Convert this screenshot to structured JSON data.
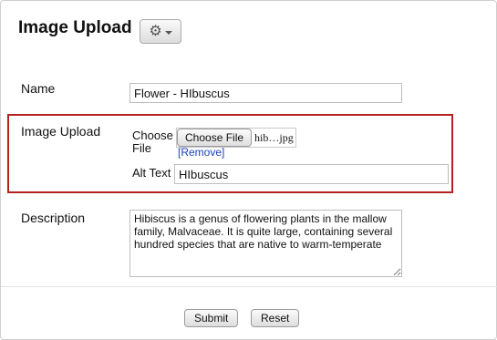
{
  "page": {
    "title": "Image Upload",
    "settings_icon": "gear-icon"
  },
  "form": {
    "name": {
      "label": "Name",
      "value": "Flower - HIbuscus"
    },
    "image_upload": {
      "label": "Image Upload",
      "choose_file_label": "Choose File",
      "choose_file_button": "Choose File",
      "file_name": "hib…jpg",
      "remove_link": "[Remove]",
      "alt_text_label": "Alt Text",
      "alt_text_value": "HIbuscus",
      "highlight_color": "#b22222"
    },
    "description": {
      "label": "Description",
      "value": "Hibiscus is a genus of flowering plants in the mallow family, Malvaceae. It is quite large, containing several hundred species that are native to warm-temperate"
    }
  },
  "actions": {
    "submit_label": "Submit",
    "reset_label": "Reset"
  }
}
